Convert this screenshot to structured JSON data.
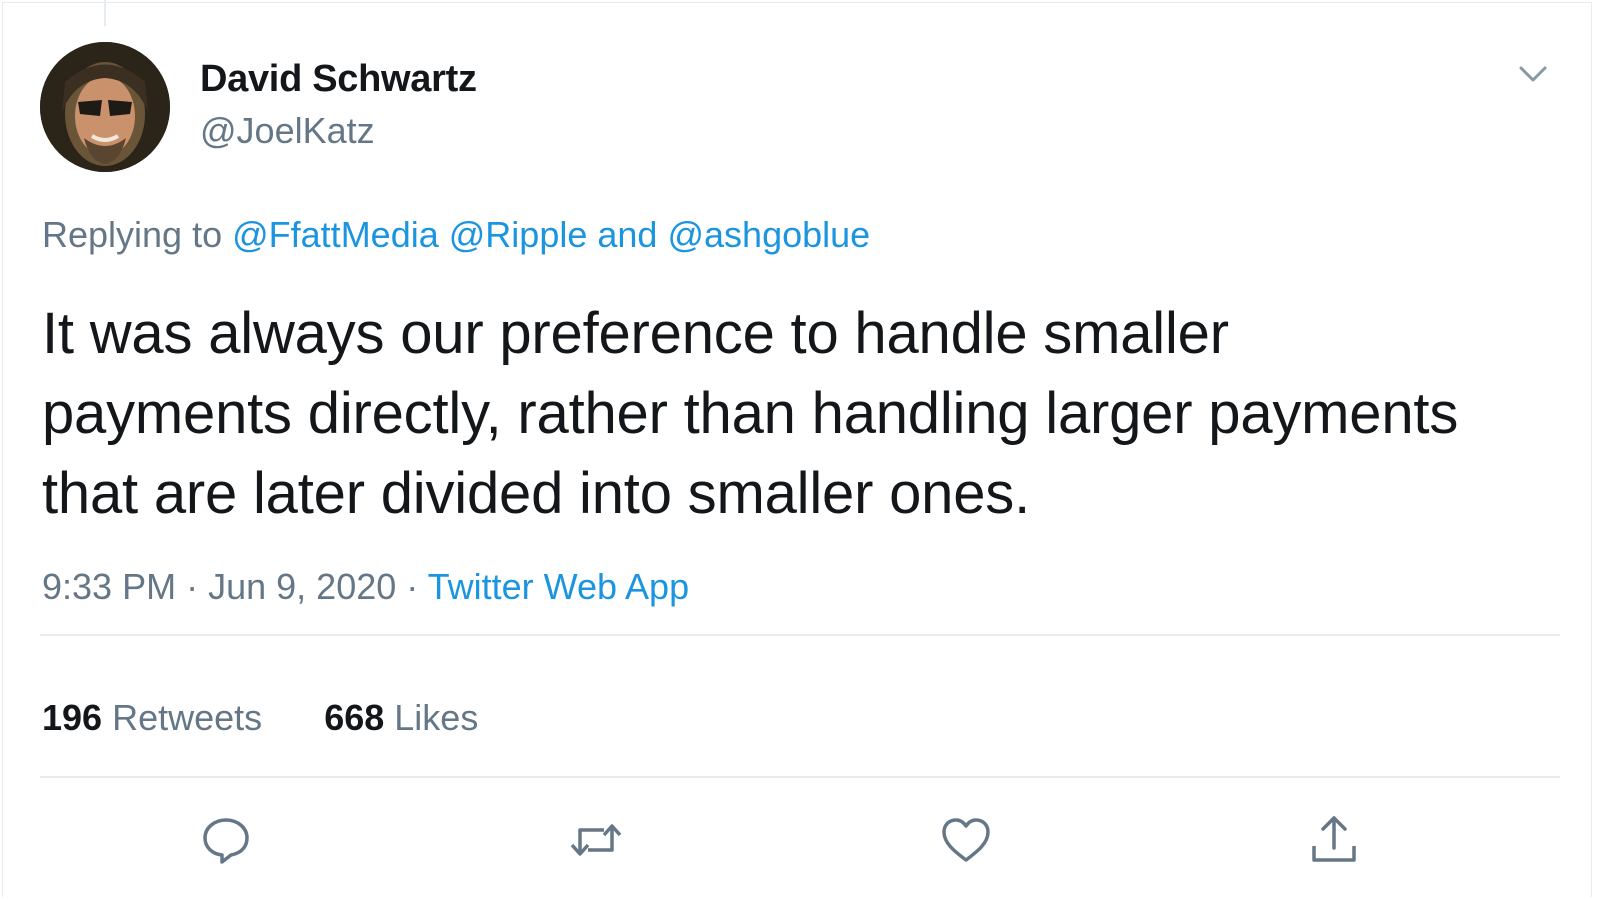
{
  "author": {
    "display_name": "David Schwartz",
    "handle": "@JoelKatz"
  },
  "reply_context": {
    "prefix": "Replying to",
    "mentions": [
      "@FfattMedia",
      "@Ripple"
    ],
    "and_word": "and",
    "last_mention": "@ashgoblue"
  },
  "tweet": {
    "text": "It was always our preference to handle smaller payments directly, rather than handling larger payments that are later divided into smaller ones."
  },
  "meta": {
    "time": "9:33 PM",
    "separator": "·",
    "date": "Jun 9, 2020",
    "source": "Twitter Web App"
  },
  "stats": {
    "retweets_count": "196",
    "retweets_label": "Retweets",
    "likes_count": "668",
    "likes_label": "Likes"
  },
  "actions": [
    "reply-icon",
    "retweet-icon",
    "like-icon",
    "share-icon"
  ],
  "colors": {
    "link": "#1b95e0",
    "secondary_text": "#657786",
    "primary_text": "#14171a",
    "divider": "#e6ecf0"
  }
}
